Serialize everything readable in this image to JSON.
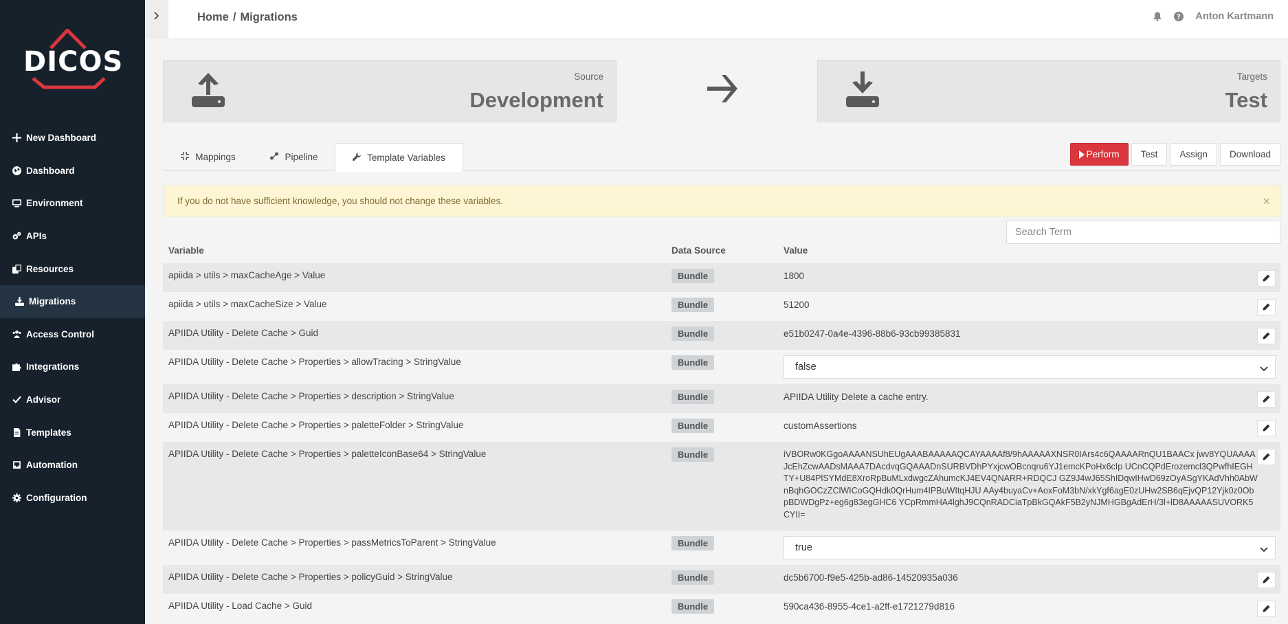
{
  "app": {
    "logo_text": "DICOS"
  },
  "sidebar": {
    "items": [
      {
        "label": "New Dashboard",
        "icon": "plus-icon"
      },
      {
        "label": "Dashboard",
        "icon": "globe-icon"
      },
      {
        "label": "Environment",
        "icon": "monitor-icon"
      },
      {
        "label": "APIs",
        "icon": "cogs-icon"
      },
      {
        "label": "Resources",
        "icon": "copy-icon"
      },
      {
        "label": "Migrations",
        "icon": "download-icon",
        "active": true
      },
      {
        "label": "Access Control",
        "icon": "users-icon"
      },
      {
        "label": "Integrations",
        "icon": "puzzle-icon"
      },
      {
        "label": "Advisor",
        "icon": "check-icon"
      },
      {
        "label": "Templates",
        "icon": "file-icon"
      },
      {
        "label": "Automation",
        "icon": "inbox-icon"
      },
      {
        "label": "Configuration",
        "icon": "gear-icon"
      }
    ]
  },
  "header": {
    "breadcrumb": {
      "home": "Home",
      "sep": "/",
      "current": "Migrations"
    },
    "user": "Anton Kartmann"
  },
  "source": {
    "label": "Source",
    "value": "Development"
  },
  "target": {
    "label": "Targets",
    "value": "Test"
  },
  "tabs": [
    {
      "label": "Mappings"
    },
    {
      "label": "Pipeline"
    },
    {
      "label": "Template Variables",
      "active": true
    }
  ],
  "actions": {
    "perform": "Perform",
    "test": "Test",
    "assign": "Assign",
    "download": "Download"
  },
  "alert": {
    "text": "If you do not have sufficient knowledge, you should not change these variables.",
    "close": "×"
  },
  "search": {
    "placeholder": "Search Term"
  },
  "table": {
    "headers": {
      "variable": "Variable",
      "source": "Data Source",
      "value": "Value"
    },
    "rows": [
      {
        "variable": "apiida > utils > maxCacheAge > Value",
        "source": "Bundle",
        "value": "1800"
      },
      {
        "variable": "apiida > utils > maxCacheSize > Value",
        "source": "Bundle",
        "value": "51200"
      },
      {
        "variable": "APIIDA Utility - Delete Cache > Guid",
        "source": "Bundle",
        "value": "e51b0247-0a4e-4396-88b6-93cb99385831"
      },
      {
        "variable": "APIIDA Utility - Delete Cache > Properties > allowTracing > StringValue",
        "source": "Bundle",
        "value": "false"
      },
      {
        "variable": "APIIDA Utility - Delete Cache > Properties > description > StringValue",
        "source": "Bundle",
        "value": "APIIDA Utility Delete a cache entry."
      },
      {
        "variable": "APIIDA Utility - Delete Cache > Properties > paletteFolder > StringValue",
        "source": "Bundle",
        "value": "customAssertions"
      },
      {
        "variable": "APIIDA Utility - Delete Cache > Properties > paletteIconBase64 > StringValue",
        "source": "Bundle",
        "value": "iVBORw0KGgoAAAANSUhEUgAAABAAAAAQCAYAAAAf8/9hAAAAAXNSR0IArs4c6QAAAARnQU1BAACx jwv8YQUAAAAJcEhZcwAADsMAAA7DAcdvqGQAAADnSURBVDhPYxjcwOBcnqru6YJ1emcKPoHx6cIp UCnCQPdErozemcl3QPwfhIEGHTY+U84PlSYMdE8XroRpBuMLxdwgcZAhumcKJ4EV4QNARR+RDQCJ GZ9J4wJ65ShIDqwIHwD69zOyASgYKAdVhh0AbWnBqhGOCzZClWICoGQHdk0QrHum4IPBuWItqHJU AAy4buyaCv+AoxFoM3bN/xkYgf6agE0zUHw2SB6qEjvQP12Yjk0z0ObpBDWDgPz+eg6g83egGHC6 YCpRmmHA4lghJ9CQnRADCiaTpBkGQAkF5B2yNJMHGBgAdErH/3l+lD8AAAAASUVORK5CYII="
      },
      {
        "variable": "APIIDA Utility - Delete Cache > Properties > passMetricsToParent > StringValue",
        "source": "Bundle",
        "value": "true"
      },
      {
        "variable": "APIIDA Utility - Delete Cache > Properties > policyGuid > StringValue",
        "source": "Bundle",
        "value": "dc5b6700-f9e5-425b-ad86-14520935a036"
      },
      {
        "variable": "APIIDA Utility - Load Cache > Guid",
        "source": "Bundle",
        "value": "590ca436-8955-4ce1-a2ff-e1721279d816"
      }
    ]
  }
}
